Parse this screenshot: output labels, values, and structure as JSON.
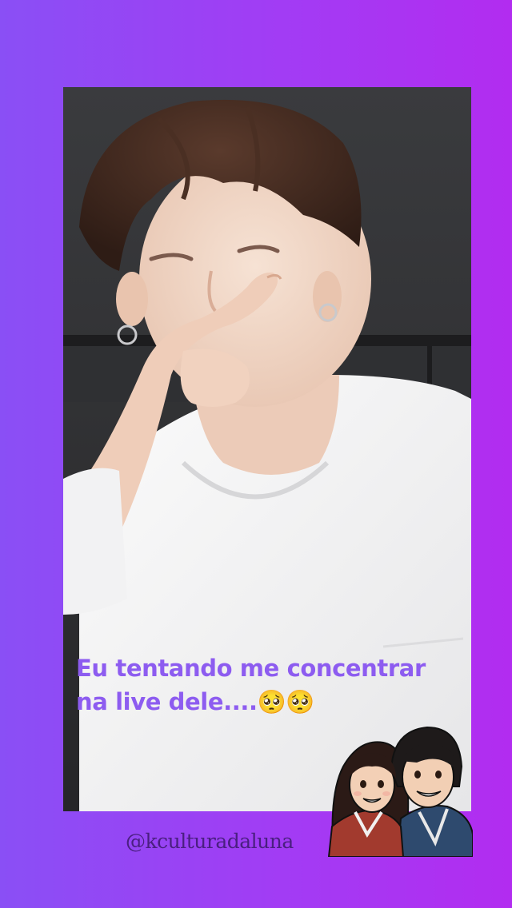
{
  "caption": {
    "line1": "Eu tentando me concentrar",
    "line2": "na live dele....🥺🥺"
  },
  "account": {
    "handle": "@kculturadaluna"
  },
  "colors": {
    "background_left": "#8a4ff5",
    "background_right": "#b22cf0",
    "caption_text": "#8d5cf0",
    "handle_text": "#4a1f80"
  },
  "icons": {
    "mascot": "korean-couple-hanbok-illustration"
  }
}
